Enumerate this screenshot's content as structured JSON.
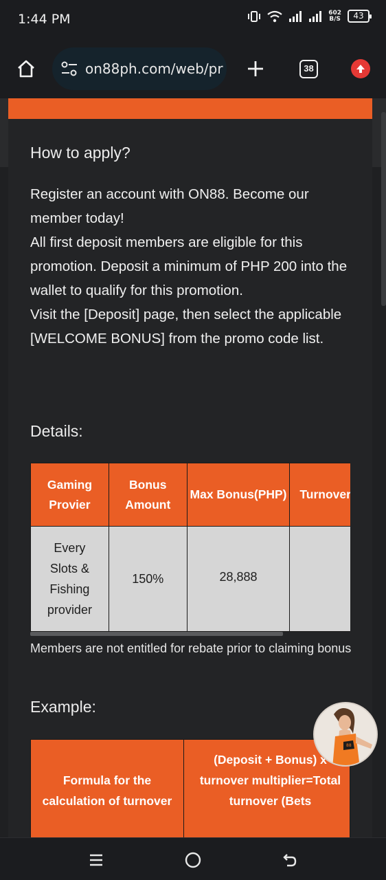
{
  "status_bar": {
    "time": "1:44 PM",
    "net_speed_value": "602",
    "net_speed_unit": "B/S",
    "battery": "43"
  },
  "browser": {
    "url": "on88ph.com/web/pr",
    "tab_count": "38"
  },
  "content": {
    "how_to_apply_title": "How to apply?",
    "how_to_apply_lines": [
      "Register an account with ON88. Become our member today!",
      "All first deposit members are eligible for this promotion. Deposit a minimum of PHP 200 into the wallet to qualify for this promotion.",
      "Visit the [Deposit] page, then select the applicable [WELCOME BONUS] from the promo code list."
    ],
    "details_title": "Details:",
    "details_table": {
      "headers": [
        "Gaming Provier",
        "Bonus Amount",
        "Max Bonus(PHP)",
        "Turnover"
      ],
      "row": [
        "Every Slots & Fishing provider",
        "150%",
        "28,888",
        ""
      ]
    },
    "note": "Members are not entitled for rebate prior to claiming bonus",
    "example_title": "Example:",
    "example_table": {
      "cells": [
        "Formula for the calculation of turnover",
        "(Deposit + Bonus) x turnover multiplier=Total turnover (Bets"
      ]
    }
  },
  "colors": {
    "accent_orange": "#ea5e25",
    "page_bg": "#1f2022",
    "table_body_bg": "#d6d6d6"
  },
  "icons": {
    "home": "home-icon",
    "tune": "site-settings-icon",
    "new_tab": "plus-icon",
    "update": "update-arrow-icon",
    "recents": "recents-icon",
    "home_nav": "home-circle-icon",
    "back": "back-icon"
  }
}
